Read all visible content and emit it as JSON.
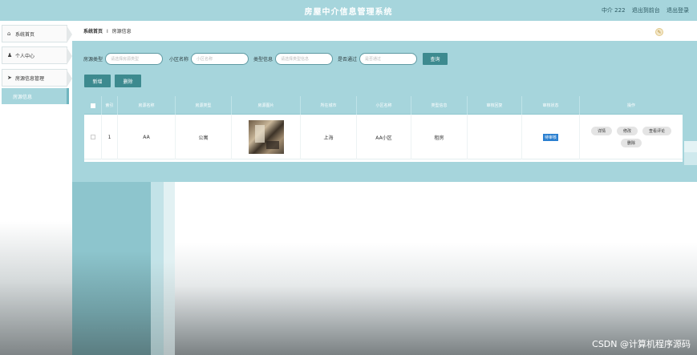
{
  "header": {
    "title": "房屋中介信息管理系统",
    "user_label": "中介 222",
    "back_link": "退出到前台",
    "logout_link": "退出登录"
  },
  "sidebar": {
    "items": [
      {
        "label": "系统首页",
        "icon": "home-icon"
      },
      {
        "label": "个人中心",
        "icon": "user-icon"
      },
      {
        "label": "房源信息管理",
        "icon": "send-icon"
      }
    ],
    "active_sub": "房源信息"
  },
  "breadcrumb": {
    "home": "系统首页",
    "separator": "I",
    "current": "房源信息"
  },
  "filters": {
    "house_type_label": "房源类型",
    "house_type_placeholder": "请选择房源类型",
    "community_label": "小区名称",
    "community_placeholder": "小区名称",
    "category_label": "类型信息",
    "category_placeholder": "请选择类型信息",
    "approved_label": "是否通过",
    "approved_placeholder": "是否通过",
    "query_button": "查询"
  },
  "actions": {
    "add_button": "新增",
    "delete_button": "删除"
  },
  "table": {
    "columns": [
      "索引",
      "房源名称",
      "房源类型",
      "房源图片",
      "所在城市",
      "小区名称",
      "类型信息",
      "审核回复",
      "审核状态",
      "操作"
    ],
    "rows": [
      {
        "index": "1",
        "name": "AA",
        "type": "公寓",
        "city": "上海",
        "community": "AA小区",
        "category": "租房",
        "reply": "",
        "status": "待审核",
        "ops": [
          "详情",
          "修改",
          "查看评论",
          "删除"
        ]
      }
    ]
  },
  "watermark": "CSDN @计算机程序源码",
  "colors": {
    "accent": "#a6d5dc",
    "button": "#3d8a8f",
    "status_highlight": "#2a7fd0"
  }
}
